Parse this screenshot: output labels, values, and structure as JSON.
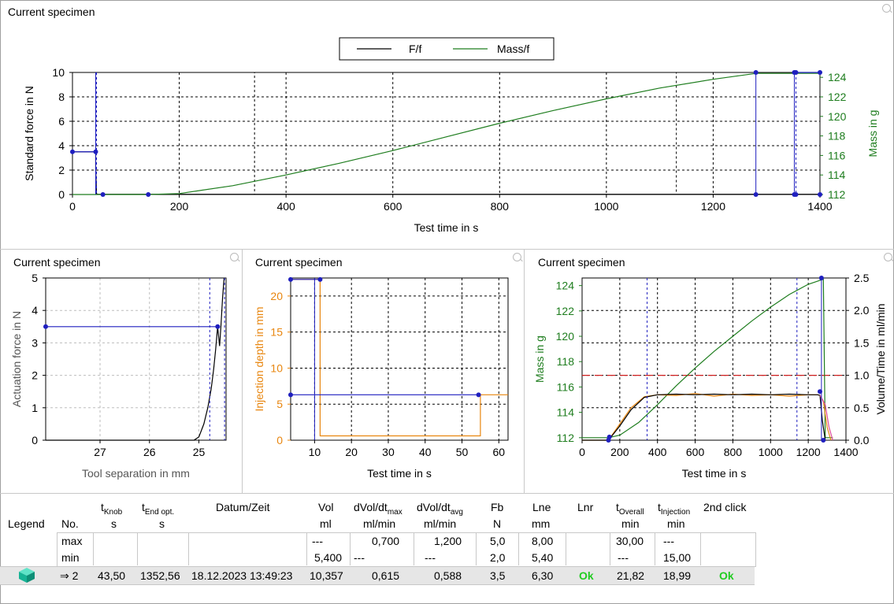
{
  "panels": {
    "main_title": "Current specimen",
    "force_title": "Current specimen",
    "injection_title": "Current specimen",
    "mass_title": "Current specimen"
  },
  "chart_data": [
    {
      "id": "main",
      "type": "line",
      "title": "",
      "xlabel": "Test time in s",
      "ylabel": "Standard force in N",
      "y2label": "Mass in g",
      "xlim": [
        0,
        1400
      ],
      "ylim": [
        0,
        10
      ],
      "y2lim": [
        112,
        124.5
      ],
      "xticks": [
        0,
        200,
        400,
        600,
        800,
        1000,
        1200,
        1400
      ],
      "yticks": [
        0,
        2,
        4,
        6,
        8,
        10
      ],
      "y2ticks": [
        112,
        114,
        116,
        118,
        120,
        122,
        124
      ],
      "legend": {
        "placement": "top-center",
        "entries": [
          "F/f",
          "Mass/f"
        ]
      },
      "grid": true,
      "series": [
        {
          "name": "F/f",
          "color": "#000000",
          "axis": "y",
          "x": [
            0,
            43.5,
            43.5,
            45,
            46,
            60,
            142,
            1280,
            1352,
            1400
          ],
          "y": [
            3.5,
            3.5,
            2.0,
            0.1,
            0.02,
            0.02,
            0.02,
            0.02,
            0.02,
            0.02
          ]
        },
        {
          "name": "Mass/f",
          "color": "#1e7d1e",
          "axis": "y2",
          "x": [
            0,
            142,
            200,
            300,
            400,
            500,
            600,
            700,
            800,
            900,
            1000,
            1100,
            1200,
            1280,
            1400
          ],
          "y": [
            112,
            112,
            112.1,
            112.9,
            114.0,
            115.2,
            116.5,
            117.9,
            119.3,
            120.6,
            121.8,
            122.9,
            123.8,
            124.4,
            124.4
          ]
        }
      ],
      "markers": {
        "color": "#1f1fbf",
        "points": [
          [
            0,
            3.5
          ],
          [
            43.5,
            3.5
          ],
          [
            57,
            0
          ],
          [
            142,
            0
          ],
          [
            1280,
            0
          ],
          [
            1352,
            0
          ],
          [
            1355,
            0
          ],
          [
            1400,
            0
          ],
          [
            1280,
            10
          ],
          [
            1352,
            10
          ],
          [
            1355,
            10
          ],
          [
            1400,
            10
          ]
        ],
        "vlines": [
          {
            "x": 43.5,
            "dashed": false
          },
          {
            "x": 45,
            "dashed": true
          },
          {
            "x": 1280,
            "dashed": false
          },
          {
            "x": 1352,
            "dashed": false
          },
          {
            "x": 1355,
            "dashed": true
          }
        ],
        "hlines": [
          {
            "y": 3.5,
            "x0": 0,
            "x1": 43.5
          },
          {
            "y": 10,
            "x0": 1352,
            "x1": 1400
          }
        ],
        "range_box": {
          "x0": 341,
          "x1": 1131,
          "y0": 0,
          "y1": 10
        }
      }
    },
    {
      "id": "force",
      "type": "line",
      "title": "",
      "xlabel": "Tool separation in mm",
      "ylabel": "Actuation force in N",
      "xlim": [
        28.1,
        24.45
      ],
      "ylim": [
        0,
        5
      ],
      "xticks": [
        27,
        26,
        25
      ],
      "yticks": [
        0,
        1,
        2,
        3,
        4,
        5
      ],
      "grid": true,
      "series": [
        {
          "name": "",
          "color": "#000000",
          "x": [
            28.1,
            25.3,
            25.1,
            25.0,
            24.9,
            24.82,
            24.75,
            24.7,
            24.66,
            24.62,
            24.58,
            24.55,
            24.52,
            24.49
          ],
          "y": [
            0,
            0,
            0,
            0.1,
            0.5,
            1.0,
            1.6,
            2.2,
            2.8,
            3.5,
            2.9,
            3.6,
            4.4,
            5.0
          ]
        }
      ],
      "markers": {
        "color": "#1f1fbf",
        "points": [
          [
            28.1,
            3.5
          ],
          [
            24.62,
            3.5
          ]
        ],
        "hlines": [
          {
            "y": 3.5,
            "x0": 28.1,
            "x1": 24.62
          }
        ],
        "vlines": [
          {
            "x": 24.78,
            "dashed": true
          },
          {
            "x": 24.48,
            "dashed": true
          }
        ]
      }
    },
    {
      "id": "injection",
      "type": "line",
      "title": "",
      "xlabel": "Test time in s",
      "ylabel": "Injection depth in mm",
      "xlim": [
        3.5,
        62.5
      ],
      "ylim": [
        0,
        22.5
      ],
      "xticks": [
        10,
        20,
        30,
        40,
        50,
        60
      ],
      "yticks": [
        0,
        5,
        10,
        15,
        20
      ],
      "grid": true,
      "series": [
        {
          "name": "",
          "color": "#e8860f",
          "x": [
            3.5,
            11.5,
            11.5,
            12.5,
            54.5,
            55,
            55,
            62.5
          ],
          "y": [
            22.3,
            22.3,
            0.6,
            0.6,
            0.6,
            0.6,
            6.3,
            6.3
          ]
        }
      ],
      "markers": {
        "color": "#1f1fbf",
        "points": [
          [
            3.5,
            22.3
          ],
          [
            11.5,
            22.3
          ],
          [
            3.5,
            6.3
          ],
          [
            54.5,
            6.3
          ]
        ],
        "hlines": [
          {
            "y": 22.3,
            "x0": 3.5,
            "x1": 11.5
          },
          {
            "y": 6.3,
            "x0": 3.5,
            "x1": 54.5
          }
        ],
        "vlines": [
          {
            "x": 10,
            "dashed": false
          }
        ]
      }
    },
    {
      "id": "mass",
      "type": "line",
      "title": "",
      "xlabel": "Test time in s",
      "ylabel": "Mass in g",
      "y2label": "Volume/Time in ml/min",
      "xlim": [
        0,
        1400
      ],
      "ylim": [
        111.8,
        124.6
      ],
      "y2lim": [
        0,
        2.5
      ],
      "xticks": [
        0,
        200,
        400,
        600,
        800,
        1000,
        1200,
        1400
      ],
      "yticks": [
        112,
        114,
        116,
        118,
        120,
        122,
        124
      ],
      "y2ticks": [
        0.0,
        0.5,
        1.0,
        1.5,
        2.0,
        2.5
      ],
      "grid": true,
      "series": [
        {
          "name": "",
          "color": "#1e7d1e",
          "axis": "y",
          "x": [
            0,
            140,
            200,
            300,
            400,
            500,
            600,
            700,
            800,
            900,
            1000,
            1100,
            1200,
            1280,
            1290,
            1330
          ],
          "y": [
            112,
            112,
            112.2,
            113.2,
            114.6,
            116.1,
            117.5,
            118.8,
            120.0,
            121.2,
            122.3,
            123.3,
            124.1,
            124.5,
            112,
            112
          ]
        },
        {
          "name": "",
          "color": "#e8860f",
          "axis": "y2",
          "x": [
            0,
            140,
            200,
            260,
            330,
            400,
            500,
            600,
            700,
            800,
            900,
            1000,
            1100,
            1200,
            1250,
            1262,
            1280,
            1300,
            1320
          ],
          "y": [
            0.0,
            0.0,
            0.25,
            0.5,
            0.67,
            0.7,
            0.69,
            0.72,
            0.68,
            0.71,
            0.69,
            0.7,
            0.68,
            0.7,
            0.7,
            0.69,
            0.6,
            0.2,
            0.0
          ]
        },
        {
          "name": "",
          "color": "#000000",
          "axis": "y2",
          "x": [
            0,
            140,
            200,
            260,
            330,
            400,
            500,
            600,
            700,
            800,
            900,
            1000,
            1100,
            1200,
            1250,
            1262,
            1275,
            1290
          ],
          "y": [
            0.0,
            0.0,
            0.22,
            0.47,
            0.66,
            0.7,
            0.71,
            0.7,
            0.71,
            0.7,
            0.71,
            0.7,
            0.71,
            0.7,
            0.7,
            0.69,
            0.3,
            0.0
          ]
        },
        {
          "name": "",
          "color": "#e04a9a",
          "axis": "y2",
          "x": [
            1262,
            1290,
            1310,
            1330
          ],
          "y": [
            0.69,
            0.55,
            0.2,
            0.0
          ]
        }
      ],
      "limit_line": {
        "y2": 1.0,
        "color": "#d02020",
        "dashed": true
      },
      "markers": {
        "color": "#1f1fbf",
        "points": [
          [
            140,
            0.0
          ],
          [
            145,
            0.05
          ],
          [
            1262,
            0.75
          ],
          [
            1270,
            2.5
          ],
          [
            1280,
            0.0
          ]
        ],
        "vlines": [
          {
            "x": 345,
            "dashed": true
          },
          {
            "x": 1140,
            "dashed": true
          },
          {
            "x": 1270,
            "dashed": false
          }
        ]
      }
    }
  ],
  "table": {
    "headers": {
      "legend": "Legend",
      "no": "No.",
      "tknob_main": "t",
      "tknob_sub": "Knob",
      "tknob_unit": "s",
      "tend_main": "t",
      "tend_sub": "End opt.",
      "tend_unit": "s",
      "datum": "Datum/Zeit",
      "vol": "Vol",
      "vol_unit": "ml",
      "dvmax_main": "dVol/dt",
      "dvmax_sub": "max",
      "dvmax_unit": "ml/min",
      "dvavg_main": "dVol/dt",
      "dvavg_sub": "avg",
      "dvavg_unit": "ml/min",
      "fb": "Fb",
      "fb_unit": "N",
      "lne": "Lne",
      "lne_unit": "mm",
      "lnr": "Lnr",
      "tov_main": "t",
      "tov_sub": "Overall",
      "tov_unit": "min",
      "tinj_main": "t",
      "tinj_sub": "Injection",
      "tinj_unit": "min",
      "click2": "2nd click"
    },
    "max_row": {
      "label": "max",
      "vol": "---",
      "dvmax": "0,700",
      "dvavg": "1,200",
      "fb": "5,0",
      "lne": "8,00",
      "tov": "30,00",
      "tinj": "---"
    },
    "min_row": {
      "label": "min",
      "vol": "5,400",
      "dvmax": "---",
      "dvavg": "---",
      "fb": "2,0",
      "lne": "5,40",
      "tov": "---",
      "tinj": "15,00"
    },
    "data_row": {
      "no": "⇒ 2",
      "tknob": "43,50",
      "tend": "1352,56",
      "datum": "18.12.2023 13:49:23",
      "vol": "10,357",
      "dvmax": "0,615",
      "dvavg": "0,588",
      "fb": "3,5",
      "lne": "6,30",
      "lnr": "Ok",
      "tov": "21,82",
      "tinj": "18,99",
      "click2": "Ok"
    },
    "legend_icon": "cube-icon",
    "ok_color": "#22cc22",
    "legend_icon_color": "#1fbfa0"
  }
}
